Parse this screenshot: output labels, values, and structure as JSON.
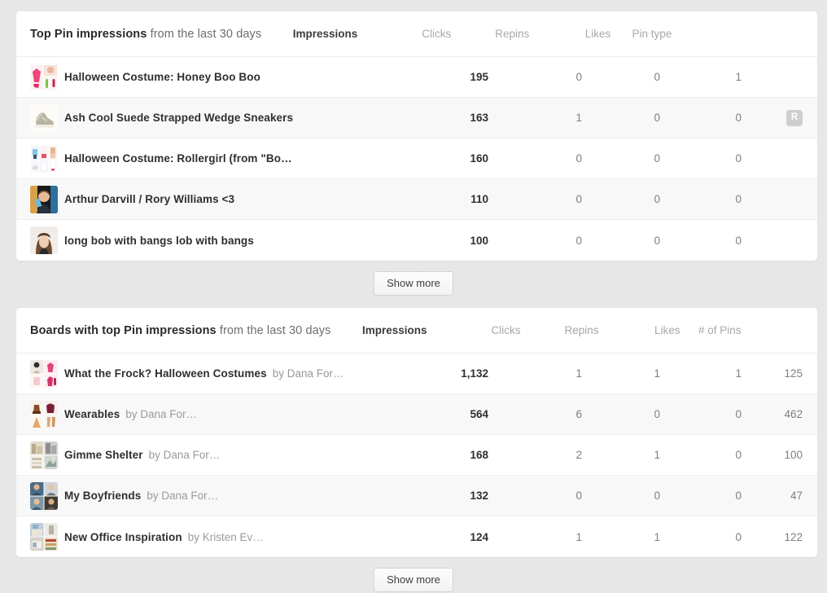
{
  "colors": {
    "page_bg": "#e7e7e7",
    "card_bg": "#ffffff",
    "row_alt_bg": "#f8f8f8",
    "text_dark": "#2f2f2f",
    "text_muted": "#9a9a9a",
    "badge_bg": "#cfcfcf"
  },
  "pins_panel": {
    "title_bold": "Top Pin impressions",
    "title_rest": " from the last 30 days",
    "columns": {
      "impressions": "Impressions",
      "clicks": "Clicks",
      "repins": "Repins",
      "likes": "Likes",
      "last": "Pin type"
    },
    "rows": [
      {
        "thumb": "collage-dress-pink-icon",
        "title": "Halloween Costume: Honey Boo Boo",
        "impressions": "195",
        "clicks": "0",
        "repins": "0",
        "likes": "1",
        "pin_type": ""
      },
      {
        "thumb": "wedge-sneaker-icon",
        "title": "Ash Cool Suede Strapped Wedge Sneakers",
        "impressions": "163",
        "clicks": "1",
        "repins": "0",
        "likes": "0",
        "pin_type": "R"
      },
      {
        "thumb": "collage-rollergirl-icon",
        "title": "Halloween Costume: Rollergirl (from \"Bo…",
        "impressions": "160",
        "clicks": "0",
        "repins": "0",
        "likes": "0",
        "pin_type": ""
      },
      {
        "thumb": "portrait-man-icon",
        "title": "Arthur Darvill / Rory Williams <3",
        "impressions": "110",
        "clicks": "0",
        "repins": "0",
        "likes": "0",
        "pin_type": ""
      },
      {
        "thumb": "portrait-woman-bob-icon",
        "title": "long bob with bangs lob with bangs",
        "impressions": "100",
        "clicks": "0",
        "repins": "0",
        "likes": "0",
        "pin_type": ""
      }
    ],
    "show_more": "Show more"
  },
  "boards_panel": {
    "title_bold": "Boards with top Pin impressions",
    "title_rest": " from the last 30 days",
    "columns": {
      "impressions": "Impressions",
      "clicks": "Clicks",
      "repins": "Repins",
      "likes": "Likes",
      "last": "# of Pins"
    },
    "rows": [
      {
        "thumb": "board-costumes-icon",
        "title": "What the Frock? Halloween Costumes",
        "byline": "by Dana For…",
        "impressions": "1,132",
        "clicks": "1",
        "repins": "1",
        "likes": "1",
        "pins": "125"
      },
      {
        "thumb": "board-wearables-icon",
        "title": "Wearables",
        "byline": "by Dana For…",
        "impressions": "564",
        "clicks": "6",
        "repins": "0",
        "likes": "0",
        "pins": "462"
      },
      {
        "thumb": "board-shelter-icon",
        "title": "Gimme Shelter",
        "byline": "by Dana For…",
        "impressions": "168",
        "clicks": "2",
        "repins": "1",
        "likes": "0",
        "pins": "100"
      },
      {
        "thumb": "board-boyfriends-icon",
        "title": "My Boyfriends",
        "byline": "by Dana For…",
        "impressions": "132",
        "clicks": "0",
        "repins": "0",
        "likes": "0",
        "pins": "47"
      },
      {
        "thumb": "board-office-icon",
        "title": "New Office Inspiration",
        "byline": "by Kristen Ev…",
        "impressions": "124",
        "clicks": "1",
        "repins": "1",
        "likes": "0",
        "pins": "122"
      }
    ],
    "show_more": "Show more"
  }
}
